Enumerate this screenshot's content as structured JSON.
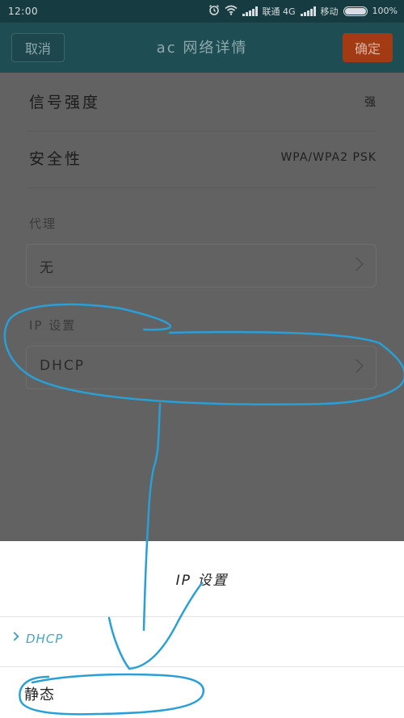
{
  "status_bar": {
    "time": "12:00",
    "carrier1": "联通 4G",
    "carrier2": "移动",
    "battery": "100%"
  },
  "titlebar": {
    "cancel": "取消",
    "title": "ac 网络详情",
    "confirm": "确定"
  },
  "details": {
    "signal_label": "信号强度",
    "signal_value": "强",
    "security_label": "安全性",
    "security_value": "WPA/WPA2 PSK",
    "proxy_label": "代理",
    "proxy_value": "无",
    "ip_label": "IP 设置",
    "ip_value": "DHCP"
  },
  "sheet": {
    "title": "IP 设置",
    "options": [
      {
        "label": "DHCP",
        "selected": true
      },
      {
        "label": "静态",
        "selected": false
      }
    ]
  },
  "colors": {
    "accent": "#4aa4b8",
    "confirm_button": "#a23b14",
    "titlebar": "#1e4d53",
    "annotation": "#2a9fd6"
  }
}
